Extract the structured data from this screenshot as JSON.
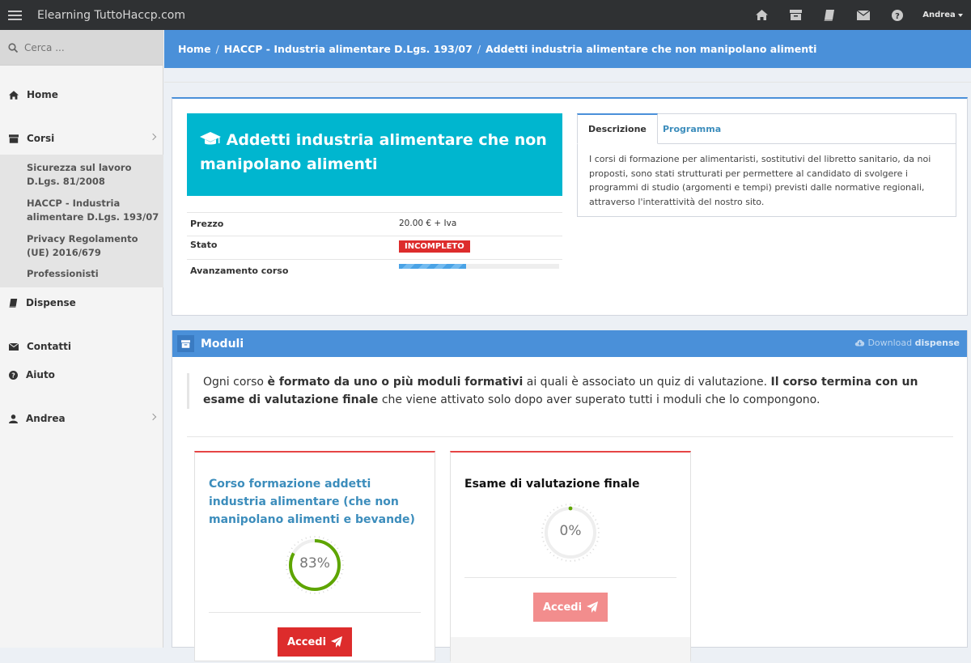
{
  "app": {
    "title": "Elearning TuttoHaccp.com",
    "user": "Andrea"
  },
  "topbar_icons": [
    "home-icon",
    "archive-icon",
    "book-icon",
    "envelope-icon",
    "question-icon"
  ],
  "search": {
    "placeholder": "Cerca ..."
  },
  "sidebar": {
    "home": "Home",
    "corsi": "Corsi",
    "sub": [
      "Sicurezza sul lavoro D.Lgs. 81/2008",
      "HACCP - Industria alimentare D.Lgs. 193/07",
      "Privacy Regolamento (UE) 2016/679",
      "Professionisti"
    ],
    "dispense": "Dispense",
    "contatti": "Contatti",
    "aiuto": "Aiuto",
    "andrea": "Andrea"
  },
  "breadcrumb": {
    "home": "Home",
    "section": "HACCP - Industria alimentare D.Lgs. 193/07",
    "current": "Addetti industria alimentare che non manipolano alimenti"
  },
  "course": {
    "title": "Addetti industria alimentare che non manipolano alimenti",
    "price_label": "Prezzo",
    "price": "20.00 € + Iva",
    "status_label": "Stato",
    "status": "INCOMPLETO",
    "progress_label": "Avanzamento corso",
    "progress": 0.42
  },
  "tabs": {
    "active": "Descrizione",
    "other": "Programma",
    "body": "I corsi di formazione per alimentaristi, sostitutivi del libretto sanitario, da noi proposti, sono stati strutturati per permettere al candidato di svolgere i programmi di studio (argomenti e tempi) previsti dalle normative regionali, attraverso l'interattività del nostro sito."
  },
  "modules": {
    "title": "Moduli",
    "download_prefix": "Download",
    "download_bold": "dispense",
    "intro": {
      "t1": "Ogni corso ",
      "b1": "è formato da uno o più moduli formativi",
      "t2": " ai quali è associato un quiz di valutazione. ",
      "b2": "Il corso termina con un esame di valutazione finale",
      "t3": " che viene attivato solo dopo aver superato tutti i moduli che lo compongono."
    },
    "cards": [
      {
        "title": "Corso formazione addetti industria alimentare (che non manipolano alimenti e bevande)",
        "percent": "83%",
        "value": 0.83,
        "button": "Accedi",
        "color": "#4aa8ff"
      },
      {
        "title": "Esame di valutazione finale",
        "percent": "0%",
        "value": 0.0,
        "button": "Accedi"
      }
    ]
  },
  "colors": {
    "accent": "#4a90d9",
    "cyan": "#00b6cf",
    "danger": "#dd2c2c",
    "ring": "#5ea500"
  }
}
